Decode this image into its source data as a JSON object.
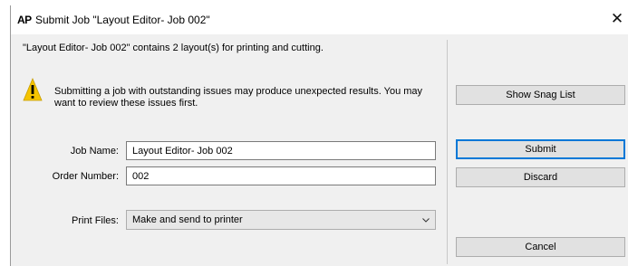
{
  "window": {
    "app_icon_text": "AP",
    "title": "Submit Job \"Layout Editor- Job 002\"",
    "close_glyph": "✕"
  },
  "summary": "\"Layout Editor- Job 002\" contains 2 layout(s) for printing and cutting.",
  "warning": {
    "icon": "warning-triangle-icon",
    "text": "Submitting a job with outstanding issues may produce unexpected results. You may want to review these issues first."
  },
  "form": {
    "job_name_label": "Job Name:",
    "job_name_value": "Layout Editor- Job 002",
    "order_number_label": "Order Number:",
    "order_number_value": "002",
    "print_files_label": "Print Files:",
    "print_files_value": "Make and send to printer"
  },
  "buttons": {
    "show_snag_list": "Show Snag List",
    "submit": "Submit",
    "discard": "Discard",
    "cancel": "Cancel"
  },
  "colors": {
    "dialog_bg": "#f0f0f0",
    "button_bg": "#e1e1e1",
    "default_button_border": "#0078d7",
    "warning_yellow": "#f5c400"
  }
}
